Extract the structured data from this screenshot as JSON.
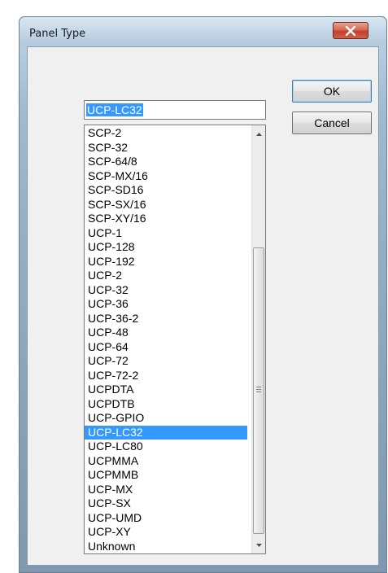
{
  "window": {
    "title": "Panel Type"
  },
  "combo": {
    "value": "UCP-LC32"
  },
  "list": {
    "items": [
      "SCP-2",
      "SCP-32",
      "SCP-64/8",
      "SCP-MX/16",
      "SCP-SD16",
      "SCP-SX/16",
      "SCP-XY/16",
      "UCP-1",
      "UCP-128",
      "UCP-192",
      "UCP-2",
      "UCP-32",
      "UCP-36",
      "UCP-36-2",
      "UCP-48",
      "UCP-64",
      "UCP-72",
      "UCP-72-2",
      "UCPDTA",
      "UCPDTB",
      "UCP-GPIO",
      "UCP-LC32",
      "UCP-LC80",
      "UCPMMA",
      "UCPMMB",
      "UCP-MX",
      "UCP-SX",
      "UCP-UMD",
      "UCP-XY",
      "Unknown"
    ],
    "selected": "UCP-LC32"
  },
  "buttons": {
    "ok": "OK",
    "cancel": "Cancel"
  },
  "colors": {
    "selection": "#3399ff",
    "close_button": "#c3412a"
  },
  "icons": {
    "close": "close-icon",
    "scroll_up": "scroll-up-arrow-icon",
    "scroll_down": "scroll-down-arrow-icon",
    "grip": "scrollbar-grip-icon"
  }
}
